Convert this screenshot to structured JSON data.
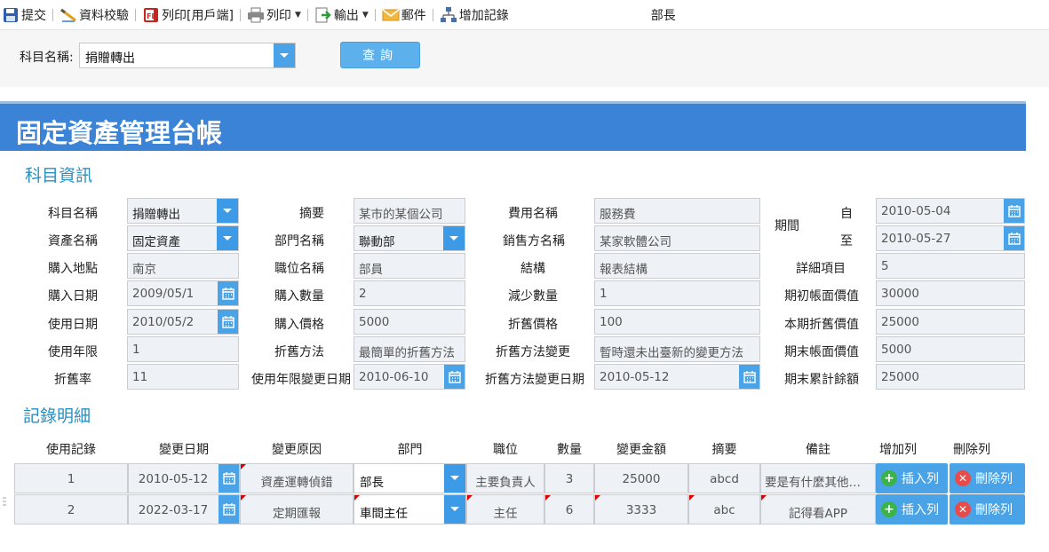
{
  "toolbar": {
    "submit": "提交",
    "validate": "資料校驗",
    "print_client": "列印[用戶端]",
    "print": "列印",
    "export": "輸出",
    "mail": "郵件",
    "add_record": "增加記錄",
    "role": "部長"
  },
  "search": {
    "label": "科目名稱:",
    "value": "捐贈轉出",
    "button": "查詢"
  },
  "title": "固定資產管理台帳",
  "section1": "科目資訊",
  "section2": "記錄明細",
  "form": {
    "subject_name_label": "科目名稱",
    "subject_name": "捐贈轉出",
    "asset_name_label": "資產名稱",
    "asset_name": "固定資產",
    "purchase_place_label": "購入地點",
    "purchase_place": "南京",
    "purchase_date_label": "購入日期",
    "purchase_date": "2009/05/1",
    "use_date_label": "使用日期",
    "use_date": "2010/05/2",
    "use_years_label": "使用年限",
    "use_years": "1",
    "depr_rate_label": "折舊率",
    "depr_rate": "11",
    "summary_label": "摘要",
    "summary": "某市的某個公司",
    "dept_label": "部門名稱",
    "dept": "聯動部",
    "position_label": "職位名稱",
    "position": "部員",
    "purchase_qty_label": "購入數量",
    "purchase_qty": "2",
    "purchase_price_label": "購入價格",
    "purchase_price": "5000",
    "depr_method_label": "折舊方法",
    "depr_method": "最簡單的折舊方法",
    "years_change_date_label": "使用年限變更日期",
    "years_change_date": "2010-06-10",
    "expense_name_label": "費用名稱",
    "expense_name": "服務費",
    "seller_label": "銷售方名稱",
    "seller": "某家軟體公司",
    "structure_label": "結構",
    "structure": "報表結構",
    "decrease_qty_label": "減少數量",
    "decrease_qty": "1",
    "depr_price_label": "折舊價格",
    "depr_price": "100",
    "method_change_label": "折舊方法變更",
    "method_change": "暫時還未出臺新的變更方法",
    "method_change_date_label": "折舊方法變更日期",
    "method_change_date": "2010-05-12",
    "period_label": "期間",
    "from_label": "自",
    "from_date": "2010-05-04",
    "to_label": "至",
    "to_date": "2010-05-27",
    "detail_items_label": "詳細項目",
    "detail_items": "5",
    "opening_book_label": "期初帳面價值",
    "opening_book": "30000",
    "current_depr_label": "本期折舊價值",
    "current_depr": "25000",
    "closing_book_label": "期末帳面價值",
    "closing_book": "5000",
    "closing_accum_label": "期末累計餘額",
    "closing_accum": "25000"
  },
  "table": {
    "headers": [
      "使用記錄",
      "變更日期",
      "變更原因",
      "部門",
      "職位",
      "數量",
      "變更金額",
      "摘要",
      "備註",
      "增加列",
      "刪除列"
    ],
    "rows": [
      {
        "no": "1",
        "date": "2010-05-12",
        "reason": "資產運轉偵錯",
        "dept": "部長",
        "position": "主要負責人",
        "qty": "3",
        "amount": "25000",
        "summary": "abcd",
        "note": "要是有什麼其他的事情"
      },
      {
        "no": "2",
        "date": "2022-03-17",
        "reason": "定期匯報",
        "dept": "車間主任",
        "position": "主任",
        "qty": "6",
        "amount": "3333",
        "summary": "abc",
        "note": "記得看APP"
      }
    ],
    "insert_label": "插入列",
    "delete_label": "刪除列"
  },
  "colors": {
    "accent": "#3a83d6",
    "button": "#4aa3e6",
    "section": "#2a8fc1"
  },
  "icons": [
    "save-icon",
    "validate-icon",
    "pdf-icon",
    "printer-icon",
    "export-icon",
    "mail-icon",
    "org-chart-icon",
    "calendar-icon",
    "chevron-down-icon",
    "plus-icon",
    "delete-icon"
  ]
}
